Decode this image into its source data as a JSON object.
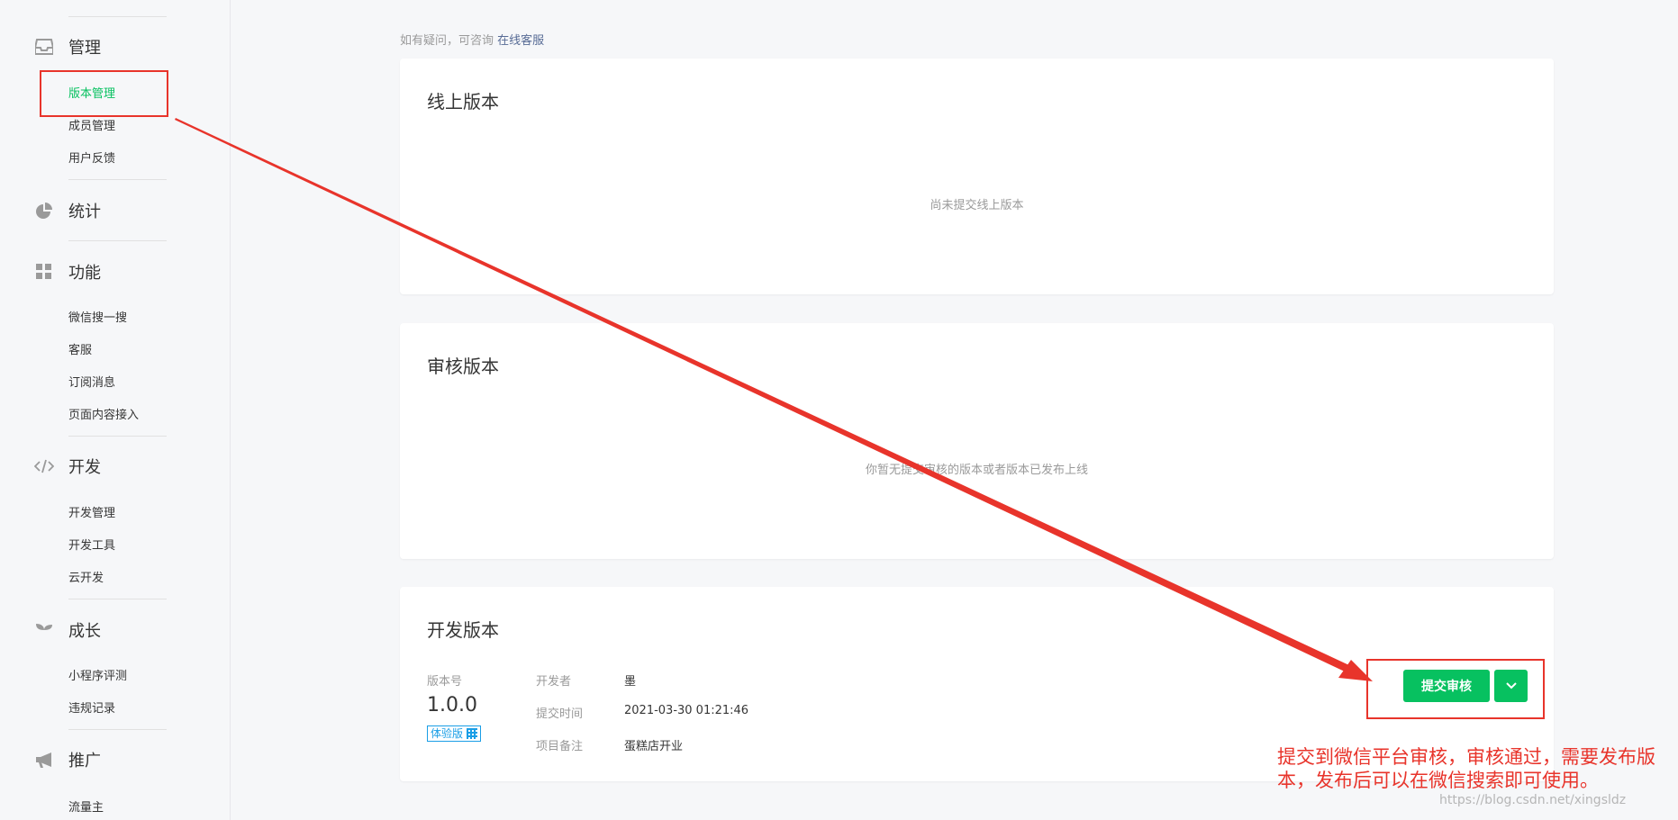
{
  "sidebar": {
    "groups": [
      {
        "title": "管理",
        "icon": "inbox-icon",
        "items": [
          "版本管理",
          "成员管理",
          "用户反馈"
        ]
      },
      {
        "title": "统计",
        "icon": "pie-chart-icon",
        "items": []
      },
      {
        "title": "功能",
        "icon": "grid-icon",
        "items": [
          "微信搜一搜",
          "客服",
          "订阅消息",
          "页面内容接入"
        ]
      },
      {
        "title": "开发",
        "icon": "code-icon",
        "items": [
          "开发管理",
          "开发工具",
          "云开发"
        ]
      },
      {
        "title": "成长",
        "icon": "sprout-icon",
        "items": [
          "小程序评测",
          "违规记录"
        ]
      },
      {
        "title": "推广",
        "icon": "megaphone-icon",
        "items": [
          "流量主"
        ]
      }
    ]
  },
  "hint": {
    "text": "如有疑问，可咨询",
    "link": "在线客服"
  },
  "online": {
    "title": "线上版本",
    "empty": "尚未提交线上版本"
  },
  "review": {
    "title": "审核版本",
    "empty": "你暂无提交审核的版本或者版本已发布上线"
  },
  "dev": {
    "title": "开发版本",
    "version_label": "版本号",
    "version": "1.0.0",
    "badge": "体验版",
    "developer_label": "开发者",
    "developer": "墨",
    "time_label": "提交时间",
    "time": "2021-03-30 01:21:46",
    "note_label": "项目备注",
    "note": "蛋糕店开业",
    "submit_label": "提交审核"
  },
  "annotation": {
    "text": "提交到微信平台审核，审核通过，需要发布版本，发布后可以在微信搜索即可使用。",
    "color": "#e8342b"
  },
  "watermark": "https://blog.csdn.net/xingsldz",
  "colors": {
    "accent": "#07c160",
    "link": "#576b95",
    "badge": "#1a9ee6"
  }
}
